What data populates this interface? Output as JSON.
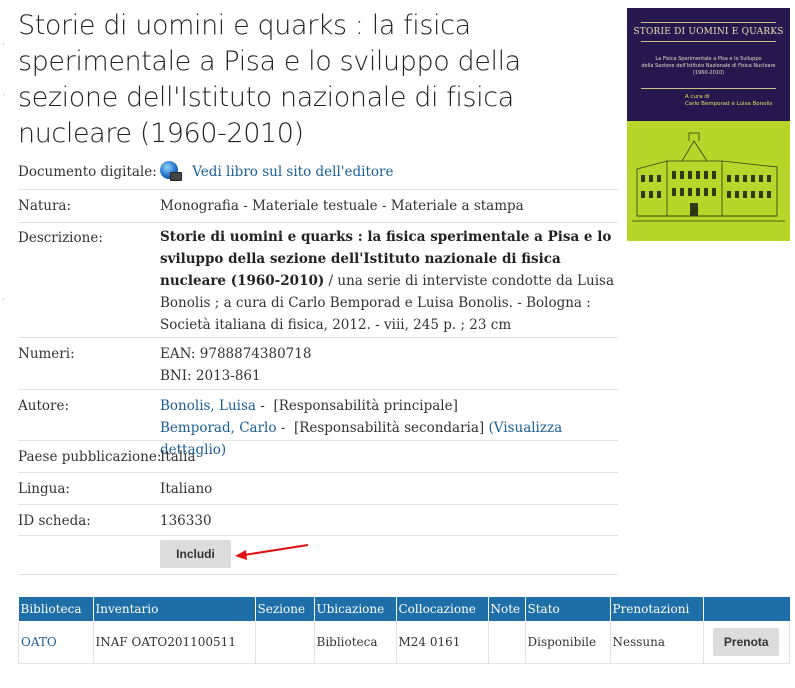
{
  "record": {
    "title": "Storie di uomini e quarks : la fisica sperimentale a Pisa e lo sviluppo della sezione dell'Istituto nazionale di fisica nucleare (1960-2010)",
    "fields": {
      "digital_label": "Documento digitale:",
      "digital_link": "Vedi libro sul sito dell'editore",
      "nature_label": "Natura:",
      "nature_value": "Monografia - Materiale testuale - Materiale a stampa",
      "desc_label": "Descrizione:",
      "desc_title": "Storie di uomini e quarks : la fisica sperimentale a Pisa e lo sviluppo della sezione dell'Istituto nazionale di fisica nucleare (1960-2010)",
      "desc_rest": " / una serie di interviste condotte da Luisa Bonolis ; a cura di Carlo Bemporad e Luisa Bonolis. - Bologna : Società italiana di fisica, 2012. - viii, 245 p. ; 23 cm",
      "numbers_label": "Numeri:",
      "ean": "EAN: 9788874380718",
      "bni": "BNI: 2013-861",
      "author_label": "Autore:",
      "author1": "Bonolis, Luisa",
      "author1_sep": " -",
      "author1_role": "[Responsabilità principale]",
      "author2": "Bemporad, Carlo",
      "author2_sep": " -",
      "author2_role": "[Responsabilità secondaria]",
      "author_detail": "(Visualizza dettaglio)",
      "country_label": "Paese pubblicazione:",
      "country_value": "Italia",
      "lang_label": "Lingua:",
      "lang_value": "Italiano",
      "id_label": "ID scheda:",
      "id_value": "136330"
    },
    "includi_label": "Includi"
  },
  "cover": {
    "title": "STORIE DI UOMINI E QUARKS",
    "subtitle_1": "La Fisica Sperimentale a Pisa e lo Sviluppo",
    "subtitle_2": "della Sezione dell'Istituto Nazionale di Fisica Nucleare",
    "subtitle_3": "(1960-2010)",
    "authors_1": "A cura di",
    "authors_2": "Carlo Bemporad e Luisa Bonolis"
  },
  "holdings": {
    "headers": [
      "Biblioteca",
      "Inventario",
      "Sezione",
      "Ubicazione",
      "Collocazione",
      "Note",
      "Stato",
      "Prenotazioni",
      ""
    ],
    "row": {
      "biblioteca": "OATO",
      "inventario": "INAF OATO201100511",
      "sezione": "",
      "ubicazione": "Biblioteca",
      "collocazione": "M24 0161",
      "note": "",
      "stato": "Disponibile",
      "prenotazioni": "Nessuna",
      "action": "Prenota"
    }
  },
  "colors": {
    "table_header": "#1e6ea8",
    "link": "#1a5e96",
    "annotation_arrow": "#e01010"
  }
}
